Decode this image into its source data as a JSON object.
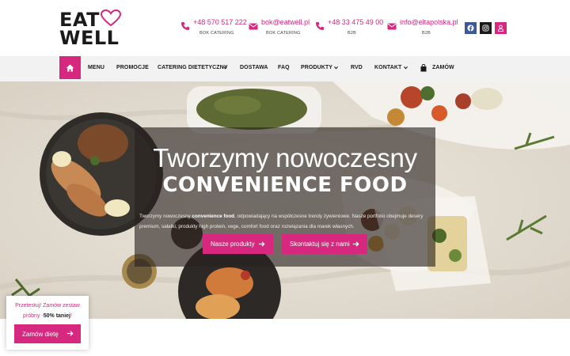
{
  "brand": {
    "logo_line1": "EAT",
    "logo_line2": "WELL",
    "accent_color": "#d6287f"
  },
  "contacts": [
    {
      "icon": "phone-icon",
      "main": "+48 570 517 222",
      "sub": "BOK CATERING"
    },
    {
      "icon": "mail-icon",
      "main": "bok@eatwell.pl",
      "sub": "BOK CATERING"
    },
    {
      "icon": "phone-icon",
      "main": "+48 33 475 49 00",
      "sub": "B2B"
    },
    {
      "icon": "mail-icon",
      "main": "info@eltapolska.pl",
      "sub": "B2B"
    }
  ],
  "social": [
    {
      "icon": "facebook-icon",
      "color": "#3b5998"
    },
    {
      "icon": "instagram-icon",
      "color": "#1a1a1a"
    },
    {
      "icon": "user-icon",
      "color": "#d6287f"
    }
  ],
  "nav": {
    "home_icon": "home-icon",
    "items": [
      {
        "label": "MENU"
      },
      {
        "label": "PROMOCJE"
      },
      {
        "label": "CATERING DIETETYCZNY",
        "dropdown": true
      },
      {
        "label": "DOSTAWA"
      },
      {
        "label": "FAQ"
      },
      {
        "label": "PRODUKTY",
        "dropdown": true
      },
      {
        "label": "RVD"
      },
      {
        "label": "KONTAKT",
        "dropdown": true
      },
      {
        "label": "ZAMÓW",
        "icon": "bag-icon"
      }
    ]
  },
  "hero": {
    "title": "Tworzymy nowoczesny",
    "subtitle": "CONVENIENCE FOOD",
    "desc_before": "Tworzymy nowoczesny ",
    "desc_bold": "convenience food",
    "desc_after": ", odpowiadający na współczesne trendy żywieniowe. Nasze portfolio obejmuje desery premium, sałatki, produkty high protein, vege, comfort food oraz rozwiązania dla marek własnych.",
    "button_products": "Nasze produkty",
    "button_contact": "Skontaktuj się z nami"
  },
  "promo": {
    "line1": "Przetestuj! Zamów zestaw",
    "line2_before": "próbny -",
    "line2_bold": "50% taniej",
    "line2_after": "!",
    "button": "Zamów dietę"
  }
}
